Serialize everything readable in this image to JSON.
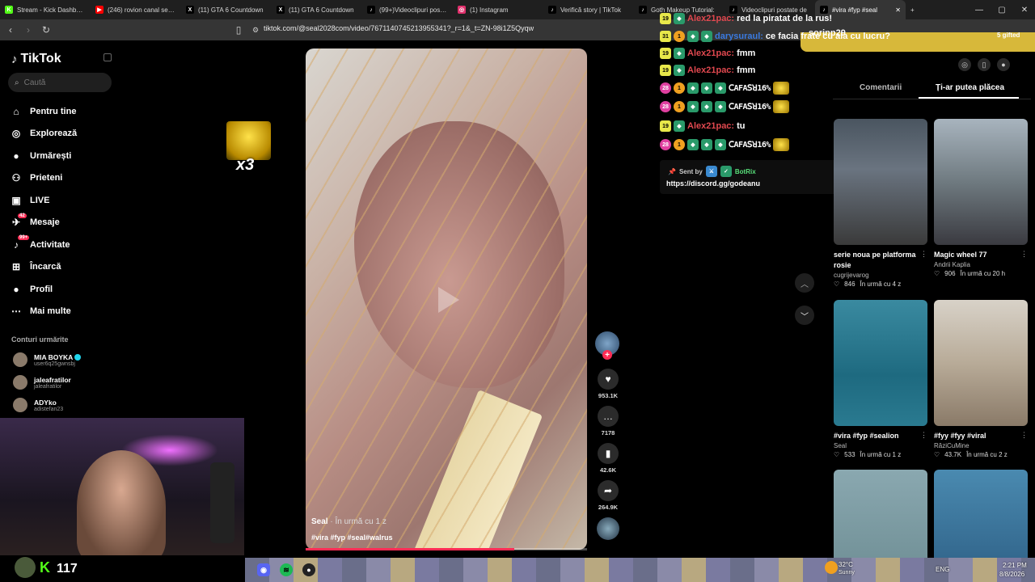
{
  "browser": {
    "tabs": [
      {
        "label": "Stream - Kick Dashboard",
        "icon": "kick-icon",
        "color": "#53fc18"
      },
      {
        "label": "(246) rovion canal secret",
        "icon": "youtube-icon",
        "color": "#ff0000"
      },
      {
        "label": "(11) GTA 6 Countdown",
        "icon": "x-icon",
        "color": "#000000"
      },
      {
        "label": "(11) GTA 6 Countdown",
        "icon": "x-icon",
        "color": "#000000"
      },
      {
        "label": "(99+)Videoclipuri postate",
        "icon": "tiktok-icon",
        "color": "#000000"
      },
      {
        "label": "(1) Instagram",
        "icon": "instagram-icon",
        "color": "#e1306c"
      },
      {
        "label": "Verifică story | TikTok",
        "icon": "tiktok-icon",
        "color": "#000000"
      },
      {
        "label": "Goth Makeup Tutorial:",
        "icon": "tiktok-icon",
        "color": "#000000"
      },
      {
        "label": "Videoclipuri postate de",
        "icon": "tiktok-icon",
        "color": "#000000"
      },
      {
        "label": "#vira #fyp #seal",
        "icon": "tiktok-icon",
        "color": "#000000",
        "active": true
      }
    ],
    "new_tab": "+",
    "url": "tiktok.com/@seal2028com/video/7671140745213955341?_r=1&_t=ZN-98i1Z5Qyqw"
  },
  "sidebar": {
    "brand": "TikTok",
    "search_placeholder": "Caută",
    "nav": [
      {
        "label": "Pentru tine",
        "icon": "home-icon"
      },
      {
        "label": "Explorează",
        "icon": "compass-icon"
      },
      {
        "label": "Urmărești",
        "icon": "following-icon"
      },
      {
        "label": "Prieteni",
        "icon": "friends-icon"
      },
      {
        "label": "LIVE",
        "icon": "live-icon"
      },
      {
        "label": "Mesaje",
        "icon": "message-icon",
        "badge": "42"
      },
      {
        "label": "Activitate",
        "icon": "activity-icon",
        "badge": "99+"
      },
      {
        "label": "Încarcă",
        "icon": "upload-icon"
      },
      {
        "label": "Profil",
        "icon": "profile-icon"
      },
      {
        "label": "Mai multe",
        "icon": "more-icon"
      }
    ],
    "following_title": "Conturi urmărite",
    "following": [
      {
        "name": "MIA BOYKA",
        "handle": "user6q25gwnsbj",
        "verified": true
      },
      {
        "name": "jaleafratilor",
        "handle": "jaleafratilor",
        "verified": false
      },
      {
        "name": "ADYko",
        "handle": "adistefan23",
        "verified": false
      }
    ]
  },
  "emote_overlay": {
    "count": "x3"
  },
  "video": {
    "author": "Seal",
    "time": "· În urmă cu 1 z",
    "tags": "#vira #fyp #seal#walrus",
    "progress": 0.74
  },
  "actions": {
    "likes": "953.1K",
    "comments": "7178",
    "saves": "42.6K",
    "shares": "264.9K"
  },
  "chat": {
    "lines": [
      {
        "badges": [
          "19",
          "kick"
        ],
        "user": "Alex21pac:",
        "msg": "red la piratat de la rus!",
        "user_color": "#e0484f"
      },
      {
        "badges": [
          "31",
          "1",
          "kick",
          "kick"
        ],
        "user": "darysuraul:",
        "msg": "ce facia frate cu ala cu lucru?",
        "user_color": "#3a7ae0"
      },
      {
        "badges": [
          "19",
          "kick"
        ],
        "user": "Alex21pac:",
        "msg": "fmm",
        "user_color": "#e0484f"
      },
      {
        "badges": [
          "19",
          "kick"
        ],
        "user": "Alex21pac:",
        "msg": "fmm",
        "user_color": "#e0484f"
      },
      {
        "badges": [
          "28",
          "1",
          "kick",
          "kick",
          "kick"
        ],
        "user": "",
        "msg": "ꓚAFAꓢꓤ16%",
        "user_color": "#ffffff",
        "emote": true
      },
      {
        "badges": [
          "28",
          "1",
          "kick",
          "kick",
          "kick"
        ],
        "user": "",
        "msg": "ꓚAFAꓢꓤ16%",
        "user_color": "#ffffff",
        "emote": true
      },
      {
        "badges": [
          "19",
          "kick"
        ],
        "user": "Alex21pac:",
        "msg": "tu",
        "user_color": "#e0484f"
      },
      {
        "badges": [
          "28",
          "1",
          "kick",
          "kick",
          "kick"
        ],
        "user": "",
        "msg": "ꓚAFAꓢꓤ16%",
        "user_color": "#ffffff",
        "emote": true
      }
    ],
    "sent_by": "Sent by",
    "bot_name": "BotRix",
    "link": "https://discord.gg/godeanu"
  },
  "gift_banner": {
    "user": "sorinp29",
    "count": "5 gifted"
  },
  "panel": {
    "tab_comments": "Comentarii",
    "tab_suggested": "Ți-ar putea plăcea",
    "cards": [
      {
        "title": "serie noua pe platforma rosie",
        "author": "cugrijevarog",
        "likes": "846",
        "time": "În urmă cu 4 z"
      },
      {
        "title": "Magic wheel 77",
        "author": "Andrii Kaplia",
        "likes": "906",
        "time": "În urmă cu 20 h"
      },
      {
        "title": "#vira #fyp #sealion",
        "author": "Seal",
        "likes": "533",
        "time": "În urmă cu 1 z"
      },
      {
        "title": "#fyy #fyy #viral",
        "author": "RăziCuMine",
        "likes": "43.7K",
        "time": "În urmă cu 2 z"
      },
      {
        "title": "",
        "author": "",
        "likes": "",
        "time": ""
      },
      {
        "title": "",
        "author": "",
        "likes": "",
        "time": ""
      }
    ]
  },
  "stream": {
    "viewers": "117"
  },
  "taskbar": {
    "weather_temp": "32°C",
    "weather_cond": "Sunny",
    "lang": "ENG",
    "time": "2:21 PM",
    "date": "8/8/2026"
  },
  "colors": {
    "accent": "#fe2c55",
    "kick_green": "#53fc18",
    "gift_banner": "#d7b83a"
  }
}
